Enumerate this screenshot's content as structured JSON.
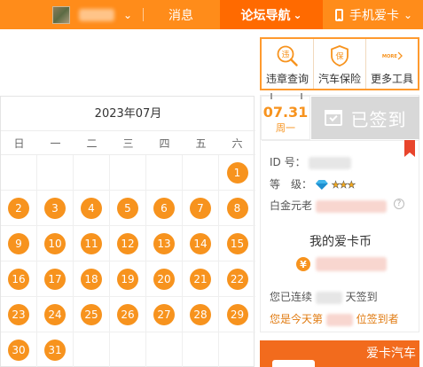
{
  "topbar": {
    "username": "",
    "messages_label": "消息",
    "forum_nav_label": "论坛导航",
    "mobile_label": "手机爱卡",
    "accent_color": "#ff8c1a",
    "active_color": "#ff6a00"
  },
  "tools": [
    {
      "label": "违章查询",
      "icon": "violation-search-icon",
      "glyph": "违"
    },
    {
      "label": "汽车保险",
      "icon": "insurance-shield-icon",
      "glyph": "保"
    },
    {
      "label": "更多工具",
      "icon": "more-arrow-icon",
      "glyph": "MORE"
    }
  ],
  "calendar": {
    "title": "2023年07月",
    "weekdays": [
      "日",
      "一",
      "二",
      "三",
      "四",
      "五",
      "六"
    ],
    "first_weekday_index": 6,
    "days_in_month": 31,
    "signed_days": [
      1,
      2,
      3,
      4,
      5,
      6,
      7,
      8,
      9,
      10,
      11,
      12,
      13,
      14,
      15,
      16,
      17,
      18,
      19,
      20,
      21,
      22,
      23,
      24,
      25,
      26,
      27,
      28,
      29,
      30,
      31
    ],
    "signed_color": "#f7931e"
  },
  "signin": {
    "date_label": "07.31",
    "weekday_label": "周一",
    "signed_label": "已签到",
    "id_label": "ID 号：",
    "level_label": "等　级：",
    "platinum_label": "白金元老",
    "help_glyph": "?",
    "coins_title": "我的爱卡币",
    "coin_symbol": "¥",
    "streak_prefix": "您已连续",
    "streak_suffix": "天签到",
    "rank_prefix": "您是今天第",
    "rank_suffix": "位签到者"
  },
  "ad": {
    "title": "爱卡汽车"
  }
}
